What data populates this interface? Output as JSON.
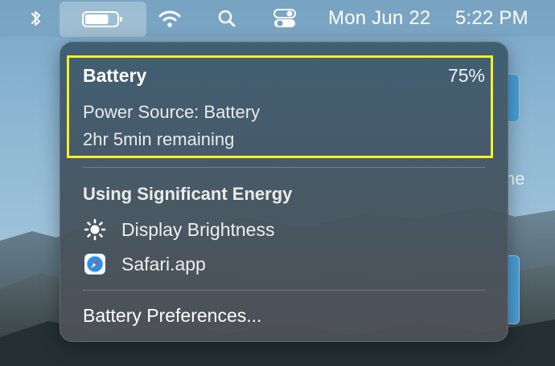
{
  "menubar": {
    "icons": [
      "bluetooth-icon",
      "battery-icon",
      "wifi-icon",
      "search-icon",
      "control-center-icon"
    ],
    "date": "Mon Jun 22",
    "time": "5:22 PM"
  },
  "battery_menu": {
    "title": "Battery",
    "percent": "75%",
    "level": 0.75,
    "power_source": "Power Source: Battery",
    "remaining": "2hr 5min remaining",
    "energy_section_title": "Using Significant Energy",
    "apps": [
      {
        "label": "Display Brightness",
        "icon": "brightness-icon"
      },
      {
        "label": "Safari.app",
        "icon": "safari-icon"
      }
    ],
    "preferences_label": "Battery Preferences..."
  },
  "background": {
    "partial_text": "ne"
  },
  "colors": {
    "highlight": "#f4f02a",
    "accent_blue": "#4a9ed6"
  }
}
